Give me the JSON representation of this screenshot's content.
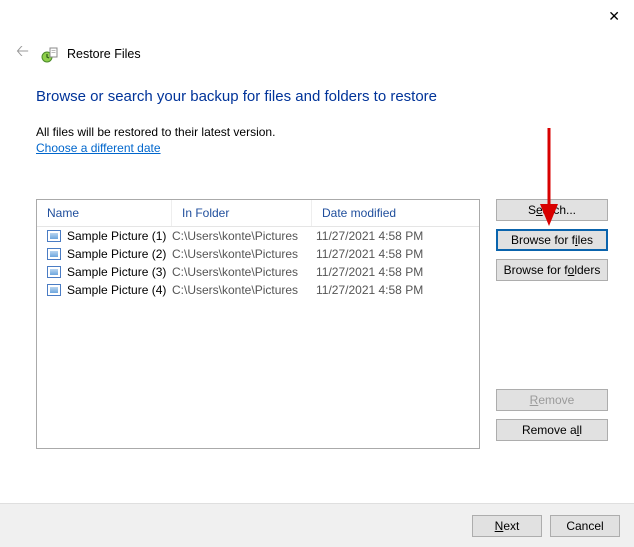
{
  "window": {
    "title": "Restore Files"
  },
  "heading": "Browse or search your backup for files and folders to restore",
  "subtext": "All files will be restored to their latest version.",
  "link_text": "Choose a different date",
  "columns": {
    "name": "Name",
    "folder": "In Folder",
    "date": "Date modified"
  },
  "rows": [
    {
      "name": "Sample Picture (1)",
      "folder": "C:\\Users\\konte\\Pictures",
      "date": "11/27/2021 4:58 PM"
    },
    {
      "name": "Sample Picture (2)",
      "folder": "C:\\Users\\konte\\Pictures",
      "date": "11/27/2021 4:58 PM"
    },
    {
      "name": "Sample Picture (3)",
      "folder": "C:\\Users\\konte\\Pictures",
      "date": "11/27/2021 4:58 PM"
    },
    {
      "name": "Sample Picture (4)",
      "folder": "C:\\Users\\konte\\Pictures",
      "date": "11/27/2021 4:58 PM"
    }
  ],
  "buttons": {
    "search": "Search...",
    "browse_files": "Browse for files",
    "browse_folders": "Browse for folders",
    "remove": "Remove",
    "remove_all": "Remove all",
    "next": "Next",
    "cancel": "Cancel"
  }
}
